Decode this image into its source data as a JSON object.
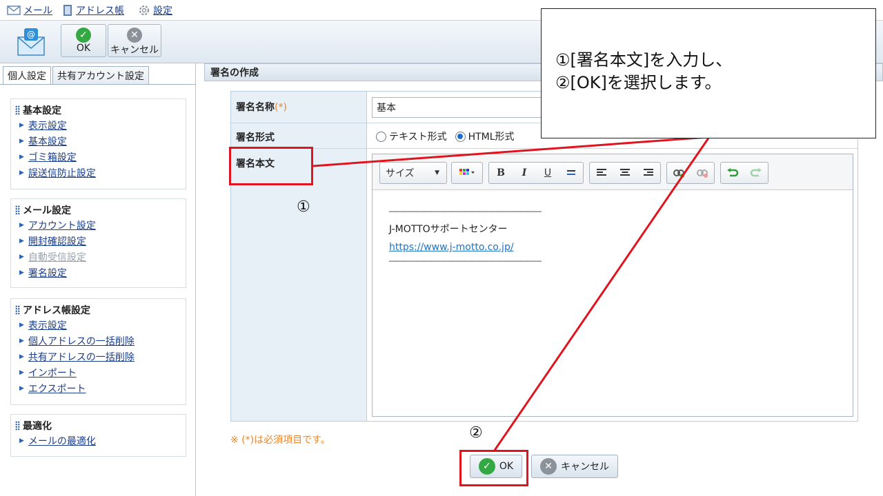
{
  "topnav": {
    "mail": "メール",
    "address_book": "アドレス帳",
    "settings": "設定"
  },
  "toolbar": {
    "ok_label": "OK",
    "cancel_label": "キャンセル"
  },
  "left": {
    "tabs": [
      {
        "label": "個人設定",
        "active": true
      },
      {
        "label": "共有アカウント設定",
        "active": false
      }
    ],
    "sections": [
      {
        "title": "基本設定",
        "items": [
          {
            "label": "表示設定"
          },
          {
            "label": "基本設定"
          },
          {
            "label": "ゴミ箱設定"
          },
          {
            "label": "誤送信防止設定"
          }
        ]
      },
      {
        "title": "メール設定",
        "items": [
          {
            "label": "アカウント設定"
          },
          {
            "label": "開封確認設定"
          },
          {
            "label": "自動受信設定",
            "disabled": true
          },
          {
            "label": "署名設定"
          }
        ]
      },
      {
        "title": "アドレス帳設定",
        "items": [
          {
            "label": "表示設定"
          },
          {
            "label": "個人アドレスの一括削除"
          },
          {
            "label": "共有アドレスの一括削除"
          },
          {
            "label": "インポート"
          },
          {
            "label": "エクスポート"
          }
        ]
      },
      {
        "title": "最適化",
        "items": [
          {
            "label": "メールの最適化"
          }
        ]
      }
    ]
  },
  "main": {
    "header_title": "署名の作成",
    "form": {
      "name_label": "署名名称",
      "required_mark": "(*)",
      "name_value": "基本",
      "format_label": "署名形式",
      "format_text": "テキスト形式",
      "format_html": "HTML形式",
      "body_label": "署名本文"
    },
    "editor": {
      "size_label": "サイズ",
      "bold": "B",
      "italic": "I",
      "underline": "U",
      "body_lines": {
        "sep1": "――――――――――――――――――――――",
        "company": "J-MOTTOサポートセンター",
        "url": "https://www.j-motto.co.jp/",
        "sep2": "――――――――――――――――――――――"
      }
    },
    "note": "※ (*)は必須項目です。",
    "ok_label": "OK",
    "cancel_label": "キャンセル"
  },
  "annotation": {
    "line1": "①[署名本文]を入力し、",
    "line2": "②[OK]を選択します。",
    "marker1": "①",
    "marker2": "②",
    "highlight_color": "#e0141e"
  },
  "icons": {
    "mail": "mail-icon",
    "address_book": "address-book-icon",
    "settings": "gear-icon",
    "new_mail": "new-mail-icon",
    "ok": "check-circle-icon",
    "cancel": "x-circle-icon"
  }
}
